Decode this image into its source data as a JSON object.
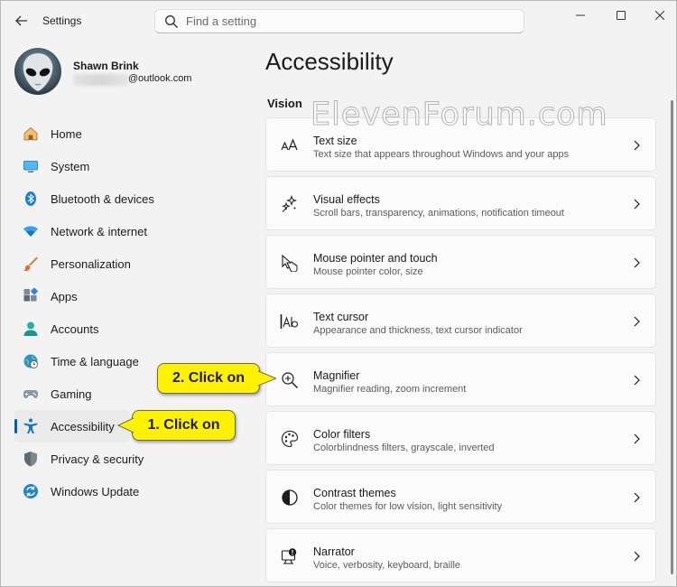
{
  "window": {
    "app_title": "Settings"
  },
  "search": {
    "placeholder": "Find a setting"
  },
  "profile": {
    "name": "Shawn Brink",
    "email_suffix": "@outlook.com"
  },
  "nav": {
    "items": [
      {
        "label": "Home",
        "icon": "home-icon"
      },
      {
        "label": "System",
        "icon": "system-icon"
      },
      {
        "label": "Bluetooth & devices",
        "icon": "bluetooth-icon"
      },
      {
        "label": "Network & internet",
        "icon": "wifi-icon"
      },
      {
        "label": "Personalization",
        "icon": "brush-icon"
      },
      {
        "label": "Apps",
        "icon": "apps-icon"
      },
      {
        "label": "Accounts",
        "icon": "accounts-icon"
      },
      {
        "label": "Time & language",
        "icon": "globe-clock-icon"
      },
      {
        "label": "Gaming",
        "icon": "gamepad-icon"
      },
      {
        "label": "Accessibility",
        "icon": "accessibility-icon"
      },
      {
        "label": "Privacy & security",
        "icon": "shield-icon"
      },
      {
        "label": "Windows Update",
        "icon": "update-icon"
      }
    ],
    "selected": "Accessibility"
  },
  "page": {
    "title": "Accessibility",
    "section": "Vision"
  },
  "watermark": "ElevenForum.com",
  "cards": [
    {
      "title": "Text size",
      "subtitle": "Text size that appears throughout Windows and your apps",
      "icon": "text-size-icon"
    },
    {
      "title": "Visual effects",
      "subtitle": "Scroll bars, transparency, animations, notification timeout",
      "icon": "visual-effects-icon"
    },
    {
      "title": "Mouse pointer and touch",
      "subtitle": "Mouse pointer color, size",
      "icon": "mouse-pointer-icon"
    },
    {
      "title": "Text cursor",
      "subtitle": "Appearance and thickness, text cursor indicator",
      "icon": "text-cursor-icon"
    },
    {
      "title": "Magnifier",
      "subtitle": "Magnifier reading, zoom increment",
      "icon": "magnifier-icon"
    },
    {
      "title": "Color filters",
      "subtitle": "Colorblindness filters, grayscale, inverted",
      "icon": "palette-icon"
    },
    {
      "title": "Contrast themes",
      "subtitle": "Color themes for low vision, light sensitivity",
      "icon": "contrast-icon"
    },
    {
      "title": "Narrator",
      "subtitle": "Voice, verbosity, keyboard, braille",
      "icon": "narrator-icon"
    }
  ],
  "callouts": {
    "step1": "1. Click on",
    "step2": "2. Click on"
  },
  "colors": {
    "accent": "#005fb8",
    "callout": "#fff200"
  }
}
